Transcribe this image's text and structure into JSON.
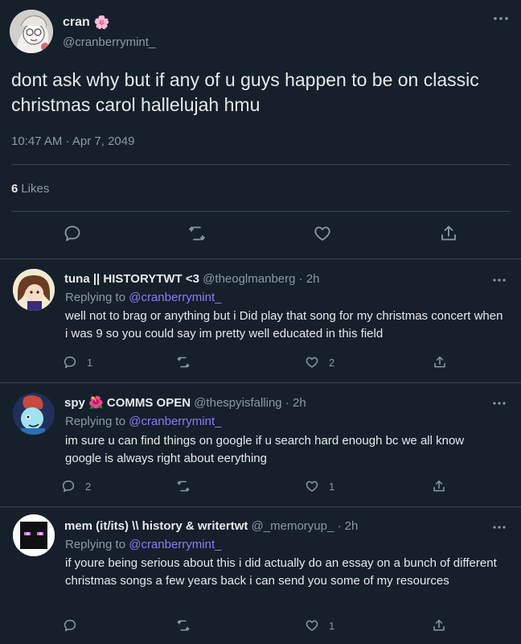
{
  "main_tweet": {
    "author_name": "cran",
    "author_emoji": "🌸",
    "author_handle": "@cranberrymint_",
    "text": "dont ask why but if any of u guys happen to be on classic christmas carol hallelujah hmu",
    "timestamp": "10:47 AM · Apr 7, 2049",
    "likes_count": "6",
    "likes_label": "Likes"
  },
  "replies": [
    {
      "name": "tuna || HISTORYTWT <3",
      "handle": "@theoglmanberg",
      "dot": "·",
      "time": "2h",
      "replying_prefix": "Replying to",
      "replying_to": "@cranberrymint_",
      "text": "well not to brag or anything but i Did play that song for my christmas concert when i was 9 so you could say im pretty well educated in this field",
      "reply_count": "1",
      "retweet_count": "",
      "like_count": "2"
    },
    {
      "name": "spy 🌺 COMMS OPEN",
      "handle": "@thespyisfalling",
      "dot": "·",
      "time": "2h",
      "replying_prefix": "Replying to",
      "replying_to": "@cranberrymint_",
      "text": "im sure u can find things on google if u search hard enough bc we all know google is always right about eerything",
      "reply_count": "2",
      "retweet_count": "",
      "like_count": "1"
    },
    {
      "name": "mem (it/its) \\\\ history & writertwt",
      "handle": "@_memoryup_",
      "dot": "·",
      "time": "2h",
      "replying_prefix": "Replying to",
      "replying_to": "@cranberrymint_",
      "text": "if youre being serious about this i did actually do an essay on a bunch of different christmas songs a few years back i can send you some of my resources",
      "reply_count": "",
      "retweet_count": "",
      "like_count": "1"
    }
  ],
  "colors": {
    "background": "#15202b",
    "divider": "#38444d",
    "text_primary": "#e7e9ea",
    "text_secondary": "#8b98a5",
    "mention": "#8c7bf7"
  },
  "icons": [
    "more-icon",
    "reply-icon",
    "retweet-icon",
    "like-icon",
    "share-icon"
  ]
}
